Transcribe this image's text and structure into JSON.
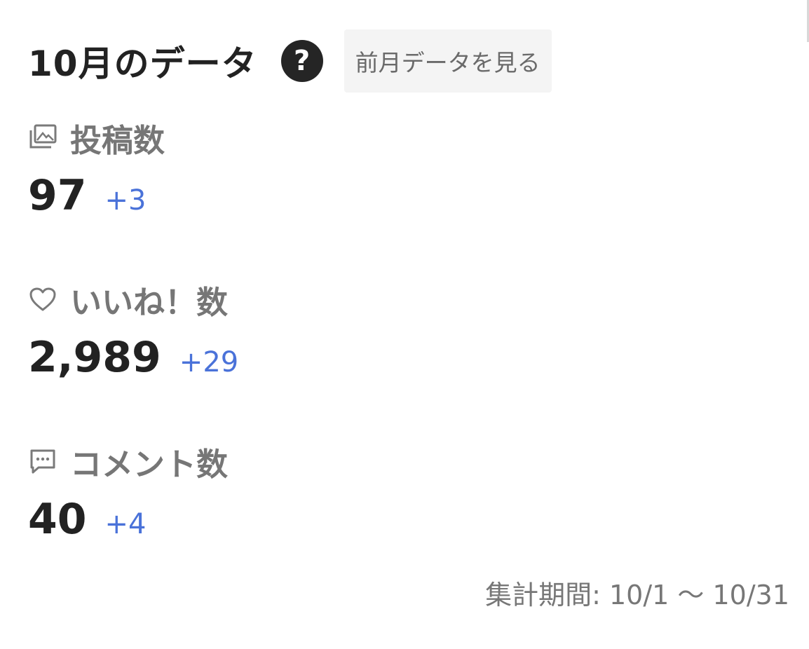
{
  "header": {
    "title": "10月のデータ",
    "help_icon": "question-circle-icon",
    "help_glyph": "?",
    "prev_button_label": "前月データを見る"
  },
  "stats": {
    "posts": {
      "icon": "photo-stack-icon",
      "label": "投稿数",
      "value": "97",
      "diff": "+3"
    },
    "likes": {
      "icon": "heart-icon",
      "label": "いいね！数",
      "value": "2,989",
      "diff": "+29"
    },
    "comments": {
      "icon": "comment-icon",
      "label": "コメント数",
      "value": "40",
      "diff": "+4"
    }
  },
  "footer": {
    "period": "集計期間: 10/1 〜 10/31"
  },
  "colors": {
    "text_primary": "#222222",
    "label_gray": "#767676",
    "diff_blue": "#4a72d9",
    "button_bg": "#f4f4f4",
    "help_bg": "#252525"
  }
}
